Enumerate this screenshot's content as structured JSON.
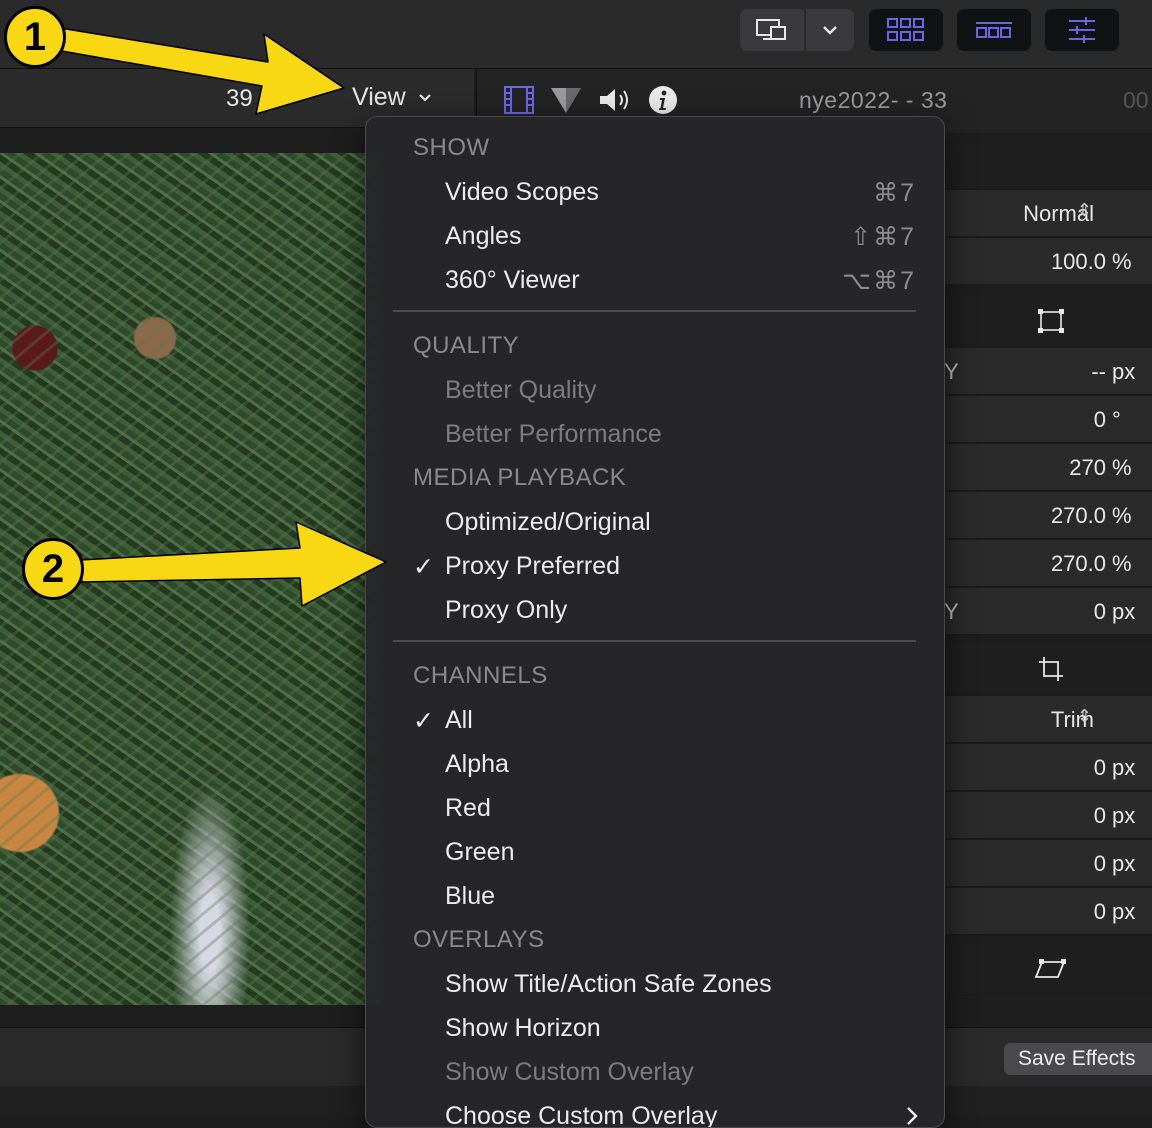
{
  "toolbar": {
    "icons": [
      "display-icon",
      "chevron-down-icon",
      "browser-grid-icon",
      "timeline-icon",
      "inspector-sliders-icon"
    ]
  },
  "viewer": {
    "timecode": "39",
    "view_menu_label": "View"
  },
  "inspector": {
    "clip_name": "nye2022- - 33",
    "timecode": "00",
    "rows": {
      "blend_mode": "Normal",
      "opacity_value": "100.0",
      "opacity_unit": "%",
      "position_y_label": "Y",
      "position_y_value": "--",
      "position_y_unit": "px",
      "rotation_value": "0",
      "rotation_unit": "°",
      "scale_all_value": "270",
      "scale_all_unit": "%",
      "scale_x_value": "270.0",
      "scale_x_unit": "%",
      "scale_y_value": "270.0",
      "scale_y_unit": "%",
      "anchor_y_label": "Y",
      "anchor_y_value": "0",
      "anchor_y_unit": "px",
      "crop_type": "Trim",
      "crop_left_value": "0",
      "crop_right_value": "0",
      "crop_top_value": "0",
      "crop_bottom_value": "0",
      "px": "px"
    },
    "save_effects_label": "Save Effects"
  },
  "menu": {
    "show_header": "SHOW",
    "video_scopes": "Video Scopes",
    "video_scopes_sc": "⌘7",
    "angles": "Angles",
    "angles_sc": "⇧⌘7",
    "viewer360": "360° Viewer",
    "viewer360_sc": "⌥⌘7",
    "quality_header": "QUALITY",
    "better_quality": "Better Quality",
    "better_performance": "Better Performance",
    "media_header": "MEDIA PLAYBACK",
    "optimized": "Optimized/Original",
    "proxy_preferred": "Proxy Preferred",
    "proxy_only": "Proxy Only",
    "channels_header": "CHANNELS",
    "all": "All",
    "alpha": "Alpha",
    "red": "Red",
    "green": "Green",
    "blue": "Blue",
    "overlays_header": "OVERLAYS",
    "safe_zones": "Show Title/Action Safe Zones",
    "horizon": "Show Horizon",
    "custom_overlay": "Show Custom Overlay",
    "choose_overlay": "Choose Custom Overlay",
    "checkmark": "✓"
  },
  "annotations": {
    "badge1": "1",
    "badge2": "2",
    "arrow_color": "#f7d812"
  },
  "colors": {
    "accent_purple": "#6e64e8"
  }
}
